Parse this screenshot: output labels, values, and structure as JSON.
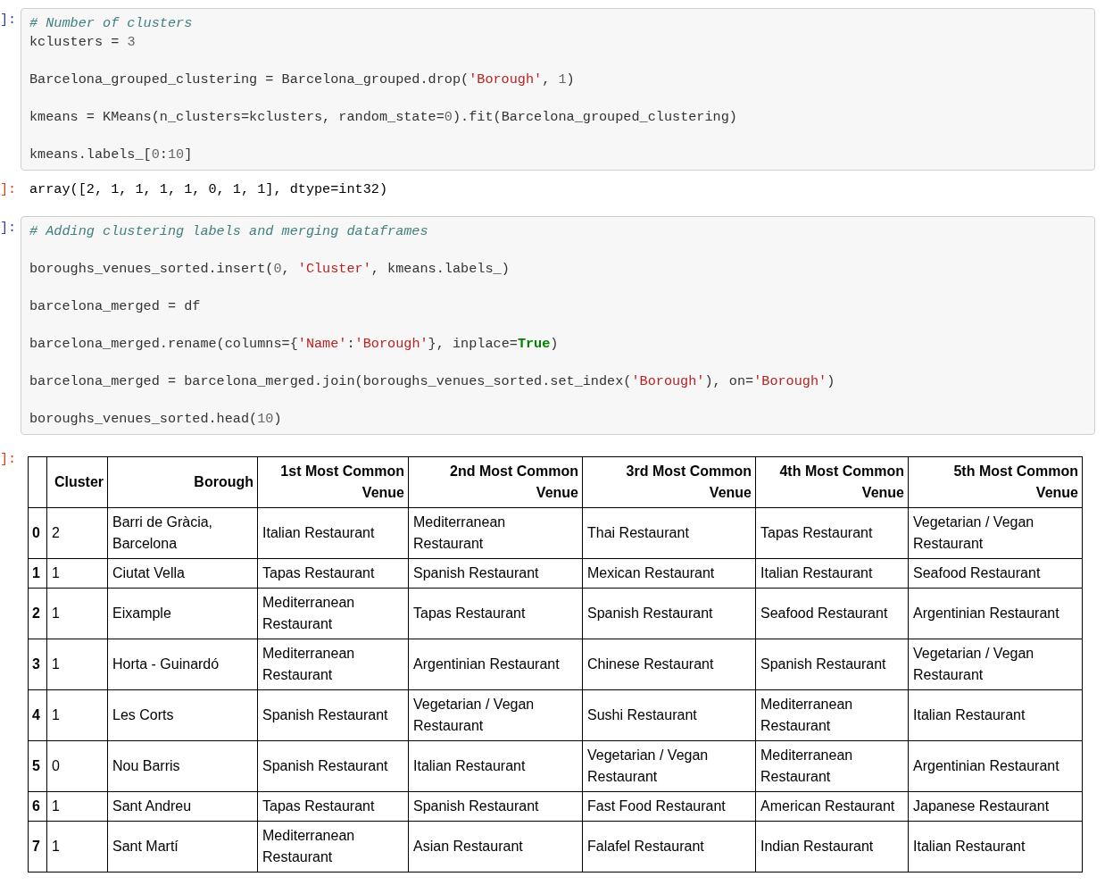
{
  "cells": [
    {
      "kind": "code",
      "prompt": "]:",
      "blocks": [
        [
          [
            {
              "kind": "comment",
              "text": "# Number of clusters"
            }
          ],
          [
            {
              "kind": "plain",
              "text": "kclusters = "
            },
            {
              "kind": "number",
              "text": "3"
            }
          ]
        ],
        [
          [
            {
              "kind": "plain",
              "text": "Barcelona_grouped_clustering = Barcelona_grouped.drop("
            },
            {
              "kind": "string",
              "text": "'Borough'"
            },
            {
              "kind": "plain",
              "text": ", "
            },
            {
              "kind": "number",
              "text": "1"
            },
            {
              "kind": "plain",
              "text": ")"
            }
          ]
        ],
        [
          [
            {
              "kind": "plain",
              "text": "kmeans = KMeans(n_clusters=kclusters, random_state="
            },
            {
              "kind": "number",
              "text": "0"
            },
            {
              "kind": "plain",
              "text": ").fit(Barcelona_grouped_clustering)"
            }
          ]
        ],
        [
          [
            {
              "kind": "plain",
              "text": "kmeans.labels_["
            },
            {
              "kind": "number",
              "text": "0"
            },
            {
              "kind": "plain",
              "text": ":"
            },
            {
              "kind": "number",
              "text": "10"
            },
            {
              "kind": "plain",
              "text": "]"
            }
          ]
        ]
      ]
    },
    {
      "kind": "text_output",
      "prompt": "]:",
      "text": "array([2, 1, 1, 1, 1, 0, 1, 1], dtype=int32)"
    },
    {
      "kind": "code",
      "prompt": "]:",
      "blocks": [
        [
          [
            {
              "kind": "comment",
              "text": "# Adding clustering labels and merging dataframes"
            }
          ]
        ],
        [
          [
            {
              "kind": "plain",
              "text": "boroughs_venues_sorted.insert("
            },
            {
              "kind": "number",
              "text": "0"
            },
            {
              "kind": "plain",
              "text": ", "
            },
            {
              "kind": "string",
              "text": "'Cluster'"
            },
            {
              "kind": "plain",
              "text": ", kmeans.labels_)"
            }
          ]
        ],
        [
          [
            {
              "kind": "plain",
              "text": "barcelona_merged = df"
            }
          ]
        ],
        [
          [
            {
              "kind": "plain",
              "text": "barcelona_merged.rename(columns={"
            },
            {
              "kind": "string",
              "text": "'Name'"
            },
            {
              "kind": "plain",
              "text": ":"
            },
            {
              "kind": "string",
              "text": "'Borough'"
            },
            {
              "kind": "plain",
              "text": "}, inplace="
            },
            {
              "kind": "keyword",
              "text": "True"
            },
            {
              "kind": "plain",
              "text": ")"
            }
          ]
        ],
        [
          [
            {
              "kind": "plain",
              "text": "barcelona_merged = barcelona_merged.join(boroughs_venues_sorted.set_index("
            },
            {
              "kind": "string",
              "text": "'Borough'"
            },
            {
              "kind": "plain",
              "text": "), on="
            },
            {
              "kind": "string",
              "text": "'Borough'"
            },
            {
              "kind": "plain",
              "text": ")"
            }
          ]
        ],
        [
          [
            {
              "kind": "plain",
              "text": "boroughs_venues_sorted.head("
            },
            {
              "kind": "number",
              "text": "10"
            },
            {
              "kind": "plain",
              "text": ")"
            }
          ]
        ]
      ]
    },
    {
      "kind": "table_output",
      "prompt": "]:",
      "table": {
        "columns": [
          "Cluster",
          "Borough",
          "1st Most Common Venue",
          "2nd Most Common Venue",
          "3rd Most Common Venue",
          "4th Most Common Venue",
          "5th Most Common Venue"
        ],
        "rows": [
          {
            "index": "0",
            "cells": [
              "2",
              "Barri de Gràcia, Barcelona",
              "Italian Restaurant",
              "Mediterranean Restaurant",
              "Thai Restaurant",
              "Tapas Restaurant",
              "Vegetarian / Vegan Restaurant"
            ]
          },
          {
            "index": "1",
            "cells": [
              "1",
              "Ciutat Vella",
              "Tapas Restaurant",
              "Spanish Restaurant",
              "Mexican Restaurant",
              "Italian Restaurant",
              "Seafood Restaurant"
            ]
          },
          {
            "index": "2",
            "cells": [
              "1",
              "Eixample",
              "Mediterranean Restaurant",
              "Tapas Restaurant",
              "Spanish Restaurant",
              "Seafood Restaurant",
              "Argentinian Restaurant"
            ]
          },
          {
            "index": "3",
            "cells": [
              "1",
              "Horta - Guinardó",
              "Mediterranean Restaurant",
              "Argentinian Restaurant",
              "Chinese Restaurant",
              "Spanish Restaurant",
              "Vegetarian / Vegan Restaurant"
            ]
          },
          {
            "index": "4",
            "cells": [
              "1",
              "Les Corts",
              "Spanish Restaurant",
              "Vegetarian / Vegan Restaurant",
              "Sushi Restaurant",
              "Mediterranean Restaurant",
              "Italian Restaurant"
            ]
          },
          {
            "index": "5",
            "cells": [
              "0",
              "Nou Barris",
              "Spanish Restaurant",
              "Italian Restaurant",
              "Vegetarian / Vegan Restaurant",
              "Mediterranean Restaurant",
              "Argentinian Restaurant"
            ]
          },
          {
            "index": "6",
            "cells": [
              "1",
              "Sant Andreu",
              "Tapas Restaurant",
              "Spanish Restaurant",
              "Fast Food Restaurant",
              "American Restaurant",
              "Japanese Restaurant"
            ]
          },
          {
            "index": "7",
            "cells": [
              "1",
              "Sant Martí",
              "Mediterranean Restaurant",
              "Asian Restaurant",
              "Falafel Restaurant",
              "Indian Restaurant",
              "Italian Restaurant"
            ]
          }
        ]
      }
    }
  ]
}
